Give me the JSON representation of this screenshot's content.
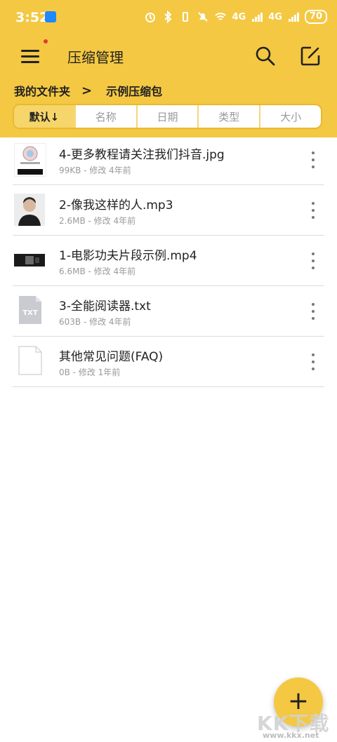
{
  "status_bar": {
    "time": "3:52",
    "battery": "70",
    "net1": "4G",
    "net2": "4G"
  },
  "app_bar": {
    "title": "压缩管理"
  },
  "breadcrumb": {
    "root": "我的文件夹",
    "current": "示例压缩包"
  },
  "sort_tabs": [
    "默认↓",
    "名称",
    "日期",
    "类型",
    "大小"
  ],
  "files": [
    {
      "name": "4-更多教程请关注我们抖音.jpg",
      "meta": "99KB - 修改 4年前",
      "type_icon": "image-thumbnail"
    },
    {
      "name": "2-像我这样的人.mp3",
      "meta": "2.6MB - 修改 4年前",
      "type_icon": "album-art-thumbnail"
    },
    {
      "name": "1-电影功夫片段示例.mp4",
      "meta": "6.6MB - 修改 4年前",
      "type_icon": "video-thumbnail"
    },
    {
      "name": "3-全能阅读器.txt",
      "meta": "603B - 修改 4年前",
      "type_icon": "txt-file-icon",
      "badge": "TXT"
    },
    {
      "name": "其他常见问题(FAQ)",
      "meta": "0B - 修改 1年前",
      "type_icon": "blank-file-icon"
    }
  ],
  "fab": {
    "label": "+"
  },
  "watermark": {
    "brand": "KK下载",
    "url": "www.kkx.net"
  },
  "colors": {
    "accent": "#f4c842",
    "active_tab": "#f6d66a",
    "divider": "#dcdcdc",
    "meta_text": "#9a9a9a"
  }
}
